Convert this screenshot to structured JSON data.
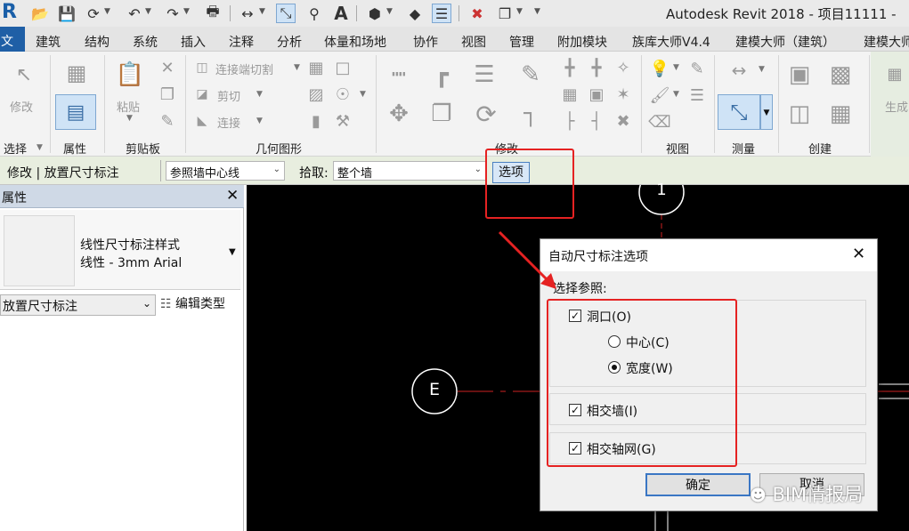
{
  "title_bar": {
    "app_title": "Autodesk Revit 2018 -    项目11111 - "
  },
  "menu": {
    "file": "文件",
    "items": [
      "建筑",
      "结构",
      "系统",
      "插入",
      "注释",
      "分析",
      "体量和场地",
      "协作",
      "视图",
      "管理",
      "附加模块",
      "族库大师V4.4",
      "建模大师（建筑）",
      "建模大师"
    ]
  },
  "ribbon": {
    "modify_label": "修改",
    "paste_label": "粘贴",
    "cope_label": "连接端切割",
    "cut_label": "剪切",
    "join_label": "连接",
    "generate_label": "生成",
    "groups": [
      "选择",
      "属性",
      "剪贴板",
      "几何图形",
      "修改",
      "视图",
      "测量",
      "创建"
    ]
  },
  "options_bar": {
    "context": "修改 | 放置尺寸标注",
    "reference": "参照墙中心线",
    "pick_label": "拾取:",
    "pick_value": "整个墙",
    "options_button": "选项"
  },
  "properties": {
    "header": "属性",
    "type_line1": "线性尺寸标注样式",
    "type_line2": "线性 - 3mm Arial",
    "instance_combo": "放置尺寸标注",
    "edit_type": "编辑类型"
  },
  "canvas": {
    "grid_label_1": "1",
    "grid_label_e": "E"
  },
  "dialog": {
    "title": "自动尺寸标注选项",
    "section": "选择参照:",
    "opening": "洞口(O)",
    "center": "中心(C)",
    "width": "宽度(W)",
    "intersect_walls": "相交墙(I)",
    "intersect_grids": "相交轴网(G)",
    "ok": "确定",
    "cancel": "取消"
  },
  "watermark": "BIM情报局",
  "colors": {
    "accent_blue": "#1f5fa6",
    "highlight_red": "#e52222",
    "canvas_bg": "#000000"
  }
}
